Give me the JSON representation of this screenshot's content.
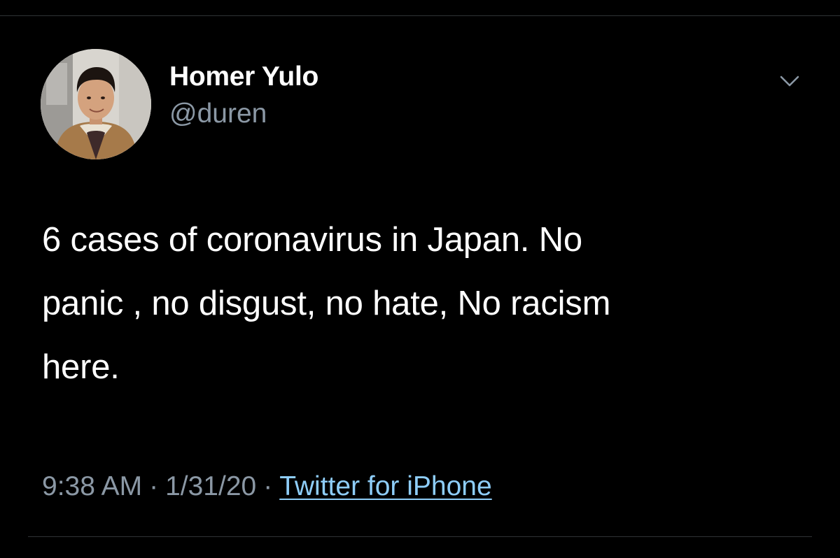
{
  "tweet": {
    "author_name": "Homer Yulo",
    "author_handle": "@duren",
    "text": "6 cases of coronavirus in Japan.  No\npanic , no disgust, no hate,  No racism\nhere.",
    "time": "9:38 AM",
    "separator": "·",
    "date": "1/31/20",
    "source": "Twitter for iPhone"
  },
  "icons": {
    "more": "chevron-down-icon",
    "avatar": "avatar"
  },
  "colors": {
    "background": "#000000",
    "primary_text": "#ffffff",
    "secondary_text": "#8b98a5",
    "link": "#8ecdf8",
    "divider": "#2f3336"
  }
}
